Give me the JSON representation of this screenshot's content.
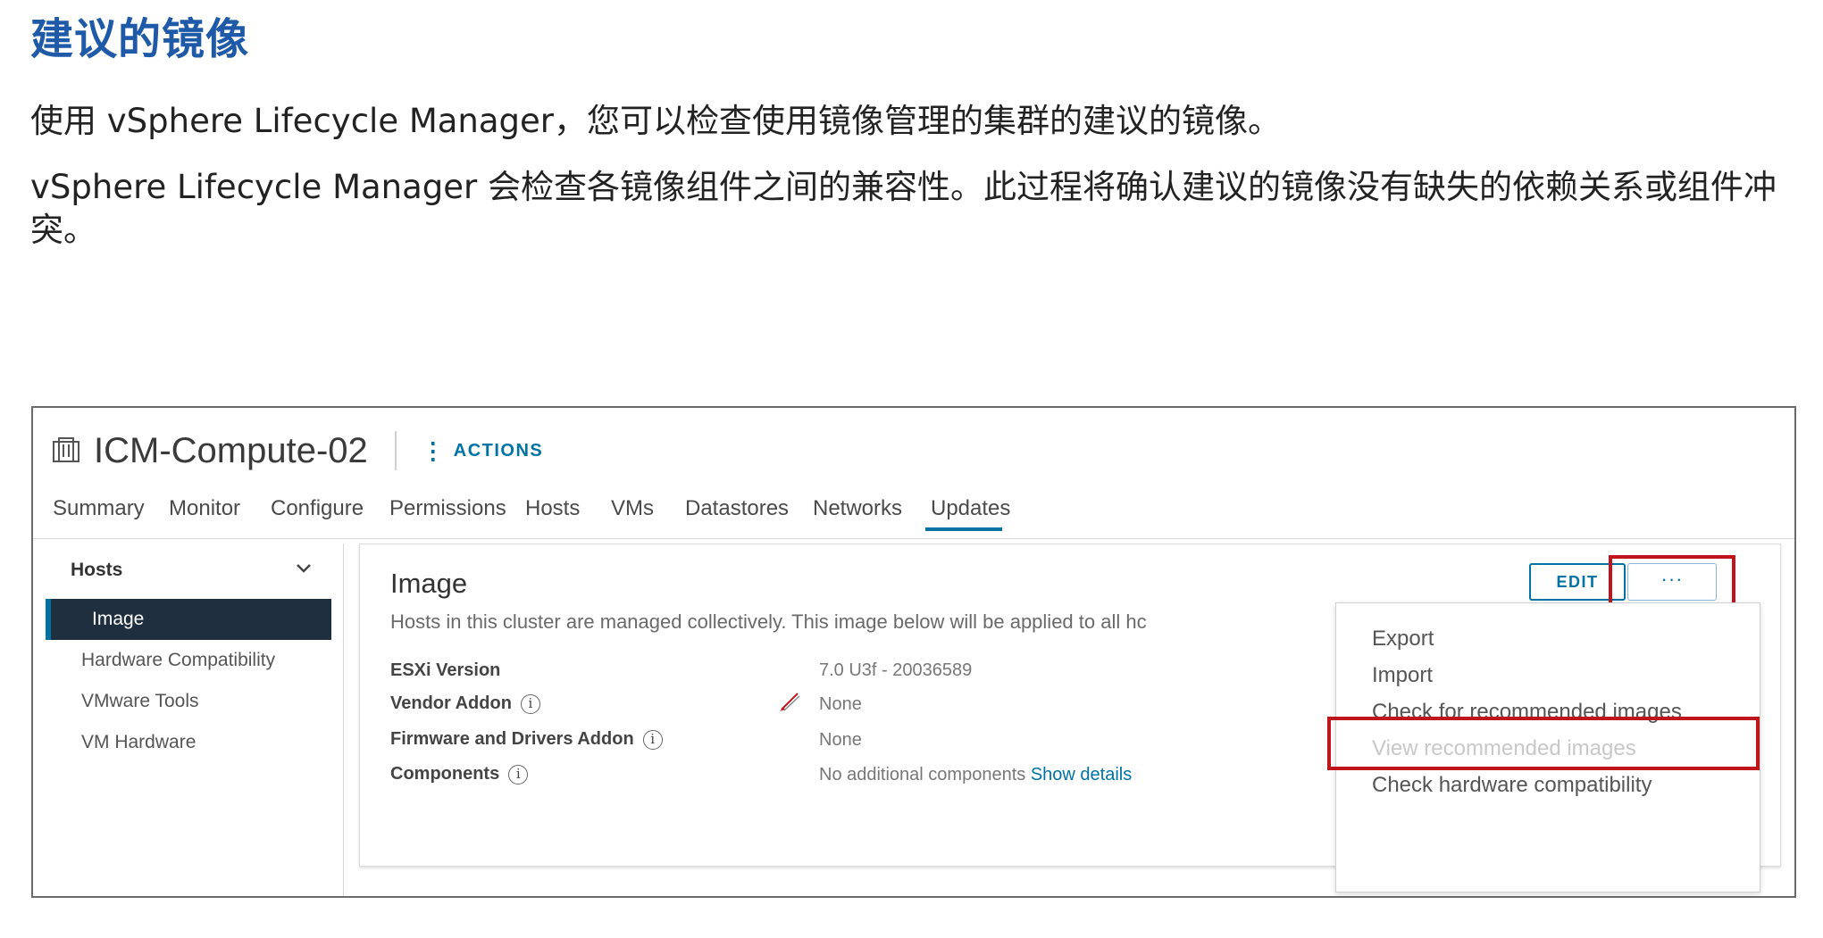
{
  "slide": {
    "title": "建议的镜像",
    "para1": "使用 vSphere Lifecycle Manager，您可以检查使用镜像管理的集群的建议的镜像。",
    "para2": "vSphere Lifecycle Manager 会检查各镜像组件之间的兼容性。此过程将确认建议的镜像没有缺失的依赖关系或组件冲突。"
  },
  "header": {
    "icon": "cluster-icon",
    "cluster_name": "ICM-Compute-02",
    "actions_label": "ACTIONS"
  },
  "tabs": [
    "Summary",
    "Monitor",
    "Configure",
    "Permissions",
    "Hosts",
    "VMs",
    "Datastores",
    "Networks",
    "Updates"
  ],
  "active_tab": "Updates",
  "sidebar": {
    "group_label": "Hosts",
    "items": [
      "Image",
      "Hardware Compatibility",
      "VMware Tools",
      "VM Hardware"
    ],
    "active_item": "Image"
  },
  "card": {
    "title": "Image",
    "description": "Hosts in this cluster are managed collectively. This image below will be applied to all hc",
    "edit_label": "EDIT",
    "more_label": "···",
    "rows": [
      {
        "label": "ESXi Version",
        "value": "7.0 U3f - 20036589",
        "info": false
      },
      {
        "label": "Vendor Addon",
        "value": "None",
        "info": true
      },
      {
        "label": "Firmware and Drivers Addon",
        "value": "None",
        "info": true
      },
      {
        "label": "Components",
        "value": "No additional components",
        "link": "Show details",
        "info": true
      }
    ]
  },
  "menu": {
    "items": [
      "Export",
      "Import",
      "Check for recommended images",
      "View recommended images",
      "Check hardware compatibility"
    ],
    "disabled": [
      "View recommended images"
    ],
    "highlighted": "Check for recommended images"
  },
  "colors": {
    "title_blue": "#1f5aa8",
    "link_blue": "#0072a3",
    "highlight_red": "#c0141c",
    "nav_active_bg": "#1f2f3f"
  }
}
